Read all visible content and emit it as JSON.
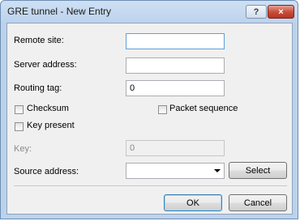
{
  "dialog": {
    "title": "GRE tunnel - New Entry",
    "help_glyph": "?",
    "close_glyph": "×"
  },
  "form": {
    "remote_site": {
      "label": "Remote site:",
      "value": ""
    },
    "server_address": {
      "label": "Server address:",
      "value": ""
    },
    "routing_tag": {
      "label": "Routing tag:",
      "value": "0"
    },
    "checksum": {
      "label": "Checksum",
      "checked": false
    },
    "packet_sequence": {
      "label": "Packet sequence",
      "checked": false
    },
    "key_present": {
      "label": "Key present",
      "checked": false
    },
    "key": {
      "label": "Key:",
      "value": "0",
      "disabled": true
    },
    "source_address": {
      "label": "Source address:",
      "value": "",
      "select_label": "Select"
    }
  },
  "buttons": {
    "ok": "OK",
    "cancel": "Cancel"
  },
  "colors": {
    "title_gradient_top": "#cfe0f3",
    "close_button": "#c8503b",
    "focus_border": "#5f9fd6"
  }
}
